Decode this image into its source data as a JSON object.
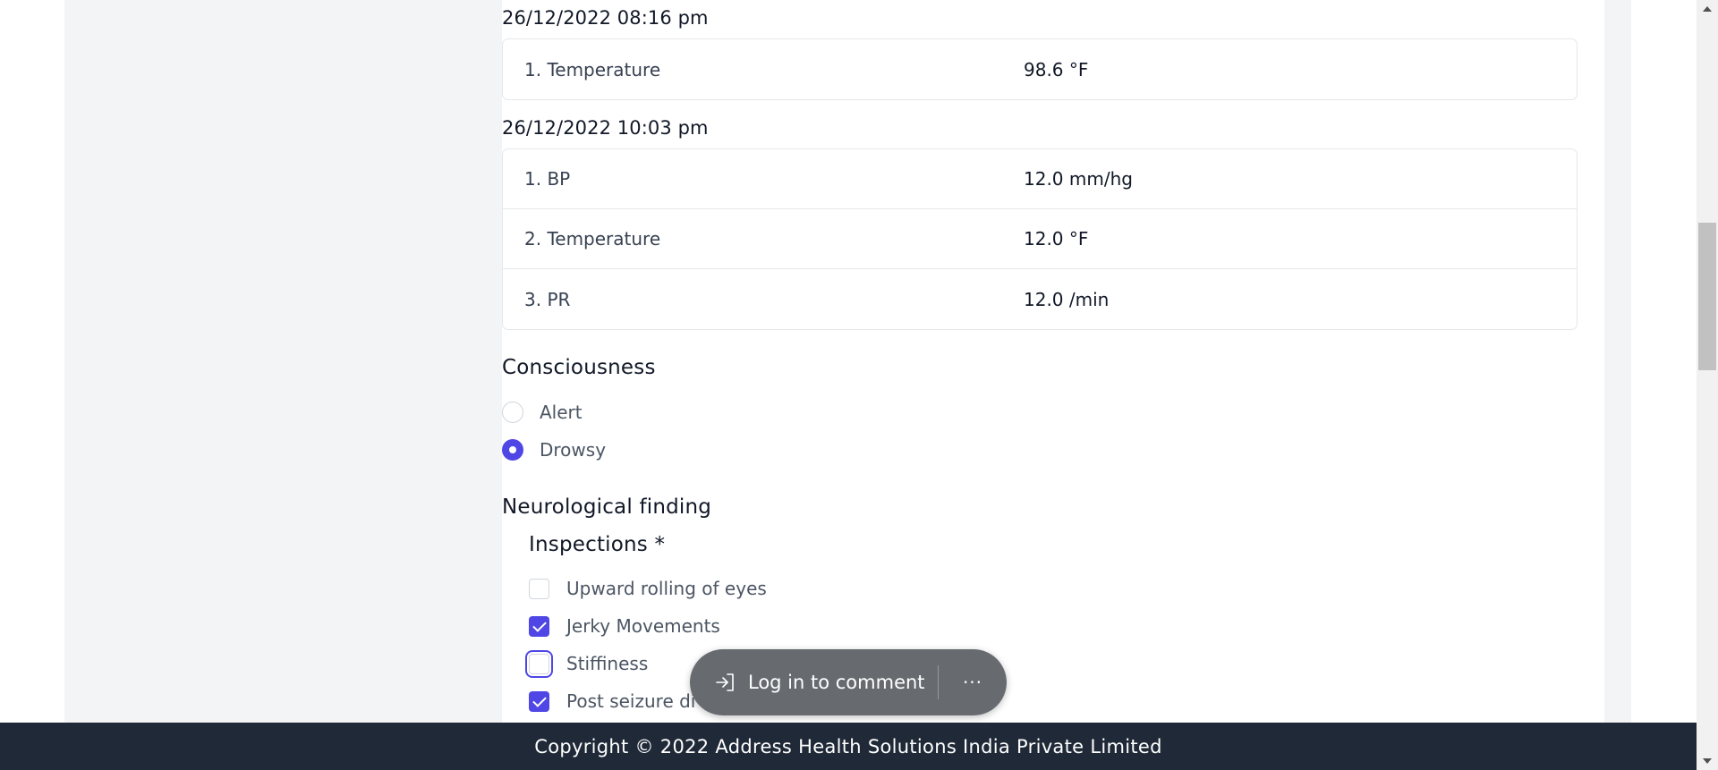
{
  "vitals": [
    {
      "timestamp": "26/12/2022 08:16 pm",
      "rows": [
        {
          "name": "1. Temperature",
          "value": "98.6 °F"
        }
      ]
    },
    {
      "timestamp": "26/12/2022 10:03 pm",
      "rows": [
        {
          "name": "1. BP",
          "value": "12.0 mm/hg"
        },
        {
          "name": "2. Temperature",
          "value": "12.0 °F"
        },
        {
          "name": "3. PR",
          "value": "12.0 /min"
        }
      ]
    }
  ],
  "consciousness": {
    "title": "Consciousness",
    "options": [
      {
        "label": "Alert",
        "checked": false
      },
      {
        "label": "Drowsy",
        "checked": true
      }
    ]
  },
  "neurological": {
    "title": "Neurological finding",
    "inspections_title": "Inspections *",
    "items": [
      {
        "label": "Upward rolling of eyes",
        "checked": false
      },
      {
        "label": "Jerky Movements",
        "checked": true
      },
      {
        "label": "Stiffiness",
        "checked": false,
        "focused": true
      },
      {
        "label": "Post seizure di",
        "checked": true
      }
    ]
  },
  "toast": {
    "label": "Log in to comment",
    "more": "···",
    "icon": "login-arrow-icon"
  },
  "footer": {
    "text": "Copyright © 2022 Address Health Solutions India Private Limited"
  },
  "colors": {
    "accent": "#4f46e5",
    "footer_bg": "#1f2937",
    "panel_bg": "#f3f4f6"
  }
}
